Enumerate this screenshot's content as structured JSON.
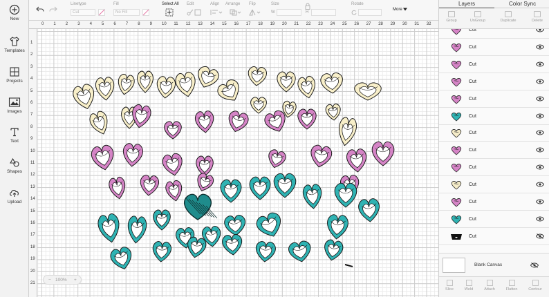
{
  "sidebar": {
    "items": [
      {
        "label": "New",
        "icon": "plus-circle-icon"
      },
      {
        "label": "Templates",
        "icon": "shirt-icon"
      },
      {
        "label": "Projects",
        "icon": "projects-grid-icon"
      },
      {
        "label": "Images",
        "icon": "image-icon"
      },
      {
        "label": "Text",
        "icon": "text-t-icon"
      },
      {
        "label": "Shapes",
        "icon": "shapes-icon"
      },
      {
        "label": "Upload",
        "icon": "upload-cloud-icon"
      }
    ]
  },
  "toolbar": {
    "linetype_label": "Linetype",
    "linetype_value": "Cut",
    "fill_label": "Fill",
    "fill_value": "No Fill",
    "select_all_label": "Select All",
    "edit_label": "Edit",
    "align_label": "Align",
    "arrange_label": "Arrange",
    "flip_label": "Flip",
    "size_label": "Size",
    "size_w_label": "W",
    "size_h_label": "H",
    "rotate_label": "Rotate",
    "more_label": "More"
  },
  "ruler": {
    "h": [
      "0",
      "1",
      "2",
      "3",
      "4",
      "5",
      "6",
      "7",
      "8",
      "9",
      "10",
      "11",
      "12",
      "13",
      "14",
      "15",
      "16",
      "17",
      "18",
      "19",
      "20",
      "21",
      "22",
      "23",
      "24",
      "25",
      "26",
      "27",
      "28",
      "29",
      "30",
      "31",
      "32"
    ],
    "v": [
      "1",
      "2",
      "3",
      "4",
      "5",
      "6",
      "7",
      "8",
      "9",
      "10",
      "11",
      "12",
      "13",
      "14",
      "15",
      "16",
      "17",
      "18",
      "19",
      "20",
      "21"
    ]
  },
  "zoom": {
    "value": "100%",
    "minus": "−",
    "plus": "+"
  },
  "panel": {
    "tabs": [
      "Layers",
      "Color Sync"
    ],
    "actions": [
      "Group",
      "UnGroup",
      "Duplicate",
      "Delete"
    ],
    "layers": [
      {
        "label": "Cut",
        "color": "#d584c6"
      },
      {
        "label": "Cut",
        "color": "#d584c6"
      },
      {
        "label": "Cut",
        "color": "#d584c6"
      },
      {
        "label": "Cut",
        "color": "#d584c6"
      },
      {
        "label": "Cut",
        "color": "#d584c6"
      },
      {
        "label": "Cut",
        "color": "#2fb3b3"
      },
      {
        "label": "Cut",
        "color": "#f5ecc8"
      },
      {
        "label": "Cut",
        "color": "#d584c6"
      },
      {
        "label": "Cut",
        "color": "#d584c6"
      },
      {
        "label": "Cut",
        "color": "#f5ecc8"
      },
      {
        "label": "Cut",
        "color": "#d584c6"
      },
      {
        "label": "Cut",
        "color": "#2fb3b3"
      },
      {
        "label": "Cut",
        "color": "#111111"
      }
    ],
    "blank_canvas_label": "Blank Canvas",
    "bottom_actions": [
      "Slice",
      "Weld",
      "Attach",
      "Flatten",
      "Contour"
    ]
  },
  "colors": {
    "pink": "#d584c6",
    "teal": "#2fb3b3",
    "cream": "#f8efc9",
    "teal_dark": "#1f8c8c"
  }
}
